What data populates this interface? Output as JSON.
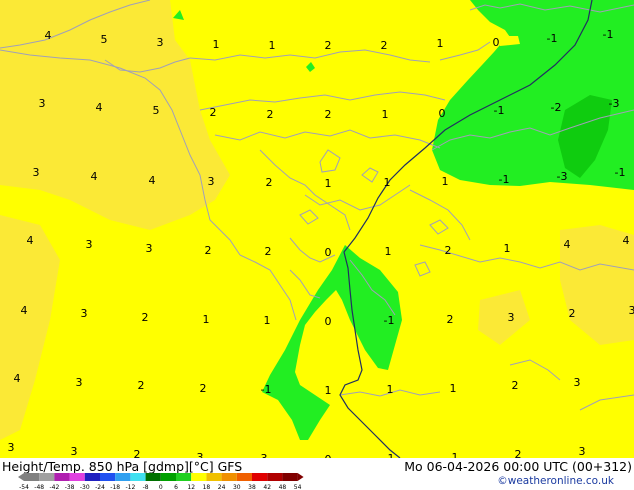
{
  "map": {
    "colors": {
      "yellow": "#ffff00",
      "light_orange": "#fbe936",
      "green": "#22ee22",
      "dark_green": "#0fcc0f",
      "border": "#a0a0b8",
      "isoline": "#203060"
    },
    "grid_values": [
      {
        "t": "4",
        "c": [
          48,
          35
        ]
      },
      {
        "t": "5",
        "c": [
          104,
          39
        ]
      },
      {
        "t": "3",
        "c": [
          160,
          42
        ]
      },
      {
        "t": "1",
        "c": [
          216,
          44
        ]
      },
      {
        "t": "1",
        "c": [
          272,
          45
        ]
      },
      {
        "t": "2",
        "c": [
          328,
          45
        ]
      },
      {
        "t": "2",
        "c": [
          384,
          45
        ]
      },
      {
        "t": "1",
        "c": [
          440,
          43
        ]
      },
      {
        "t": "0",
        "c": [
          496,
          42
        ]
      },
      {
        "t": "-1",
        "c": [
          552,
          38
        ]
      },
      {
        "t": "-1",
        "c": [
          608,
          34
        ]
      },
      {
        "t": "3",
        "c": [
          42,
          103
        ]
      },
      {
        "t": "4",
        "c": [
          99,
          107
        ]
      },
      {
        "t": "5",
        "c": [
          156,
          110
        ]
      },
      {
        "t": "2",
        "c": [
          213,
          112
        ]
      },
      {
        "t": "2",
        "c": [
          270,
          114
        ]
      },
      {
        "t": "2",
        "c": [
          328,
          114
        ]
      },
      {
        "t": "1",
        "c": [
          385,
          114
        ]
      },
      {
        "t": "0",
        "c": [
          442,
          113
        ]
      },
      {
        "t": "-1",
        "c": [
          499,
          110
        ]
      },
      {
        "t": "-2",
        "c": [
          556,
          107
        ]
      },
      {
        "t": "-3",
        "c": [
          614,
          103
        ]
      },
      {
        "t": "3",
        "c": [
          36,
          172
        ]
      },
      {
        "t": "4",
        "c": [
          94,
          176
        ]
      },
      {
        "t": "4",
        "c": [
          152,
          180
        ]
      },
      {
        "t": "3",
        "c": [
          211,
          181
        ]
      },
      {
        "t": "2",
        "c": [
          269,
          182
        ]
      },
      {
        "t": "1",
        "c": [
          328,
          183
        ]
      },
      {
        "t": "1",
        "c": [
          387,
          182
        ]
      },
      {
        "t": "1",
        "c": [
          445,
          181
        ]
      },
      {
        "t": "-1",
        "c": [
          504,
          179
        ]
      },
      {
        "t": "-3",
        "c": [
          562,
          176
        ]
      },
      {
        "t": "-1",
        "c": [
          620,
          172
        ]
      },
      {
        "t": "4",
        "c": [
          30,
          240
        ]
      },
      {
        "t": "3",
        "c": [
          89,
          244
        ]
      },
      {
        "t": "3",
        "c": [
          149,
          248
        ]
      },
      {
        "t": "2",
        "c": [
          208,
          250
        ]
      },
      {
        "t": "2",
        "c": [
          268,
          251
        ]
      },
      {
        "t": "0",
        "c": [
          328,
          252
        ]
      },
      {
        "t": "1",
        "c": [
          388,
          251
        ]
      },
      {
        "t": "2",
        "c": [
          448,
          250
        ]
      },
      {
        "t": "1",
        "c": [
          507,
          248
        ]
      },
      {
        "t": "4",
        "c": [
          567,
          244
        ]
      },
      {
        "t": "4",
        "c": [
          626,
          240
        ]
      },
      {
        "t": "4",
        "c": [
          24,
          310
        ]
      },
      {
        "t": "3",
        "c": [
          84,
          313
        ]
      },
      {
        "t": "2",
        "c": [
          145,
          317
        ]
      },
      {
        "t": "1",
        "c": [
          206,
          319
        ]
      },
      {
        "t": "1",
        "c": [
          267,
          320
        ]
      },
      {
        "t": "0",
        "c": [
          328,
          321
        ]
      },
      {
        "t": "-1",
        "c": [
          389,
          320
        ]
      },
      {
        "t": "2",
        "c": [
          450,
          319
        ]
      },
      {
        "t": "3",
        "c": [
          511,
          317
        ]
      },
      {
        "t": "2",
        "c": [
          572,
          313
        ]
      },
      {
        "t": "3",
        "c": [
          632,
          310
        ]
      },
      {
        "t": "4",
        "c": [
          17,
          378
        ]
      },
      {
        "t": "3",
        "c": [
          79,
          382
        ]
      },
      {
        "t": "2",
        "c": [
          141,
          385
        ]
      },
      {
        "t": "2",
        "c": [
          203,
          388
        ]
      },
      {
        "t": "-1",
        "c": [
          266,
          389
        ]
      },
      {
        "t": "1",
        "c": [
          328,
          390
        ]
      },
      {
        "t": "1",
        "c": [
          390,
          389
        ]
      },
      {
        "t": "1",
        "c": [
          453,
          388
        ]
      },
      {
        "t": "2",
        "c": [
          515,
          385
        ]
      },
      {
        "t": "3",
        "c": [
          577,
          382
        ]
      },
      {
        "t": "3",
        "c": [
          11,
          447
        ]
      },
      {
        "t": "3",
        "c": [
          74,
          451
        ]
      },
      {
        "t": "2",
        "c": [
          137,
          454
        ]
      },
      {
        "t": "3",
        "c": [
          200,
          457
        ]
      },
      {
        "t": "3",
        "c": [
          264,
          458
        ]
      },
      {
        "t": "0",
        "c": [
          328,
          459
        ]
      },
      {
        "t": "1",
        "c": [
          391,
          458
        ]
      },
      {
        "t": "1",
        "c": [
          455,
          457
        ]
      },
      {
        "t": "2",
        "c": [
          518,
          454
        ]
      },
      {
        "t": "3",
        "c": [
          582,
          451
        ]
      }
    ]
  },
  "footer": {
    "title": "Height/Temp. 850 hPa [gdmp][°C] GFS",
    "datetime": "Mo 06-04-2026 00:00 UTC (00+312)",
    "credit": "©weatheronline.co.uk",
    "scale_labels": [
      "-54",
      "-48",
      "-42",
      "-38",
      "-30",
      "-24",
      "-18",
      "-12",
      "-8",
      "0",
      "6",
      "12",
      "18",
      "24",
      "30",
      "38",
      "42",
      "48",
      "54"
    ],
    "scale_colors": [
      "#808080",
      "#a0a0a0",
      "#b020b0",
      "#e040e0",
      "#2020c0",
      "#2050f0",
      "#30a0f0",
      "#40e0f0",
      "#007000",
      "#00a000",
      "#20d020",
      "#ffff00",
      "#f0c000",
      "#f09000",
      "#f06000",
      "#e00000",
      "#b00000",
      "#800000"
    ]
  }
}
